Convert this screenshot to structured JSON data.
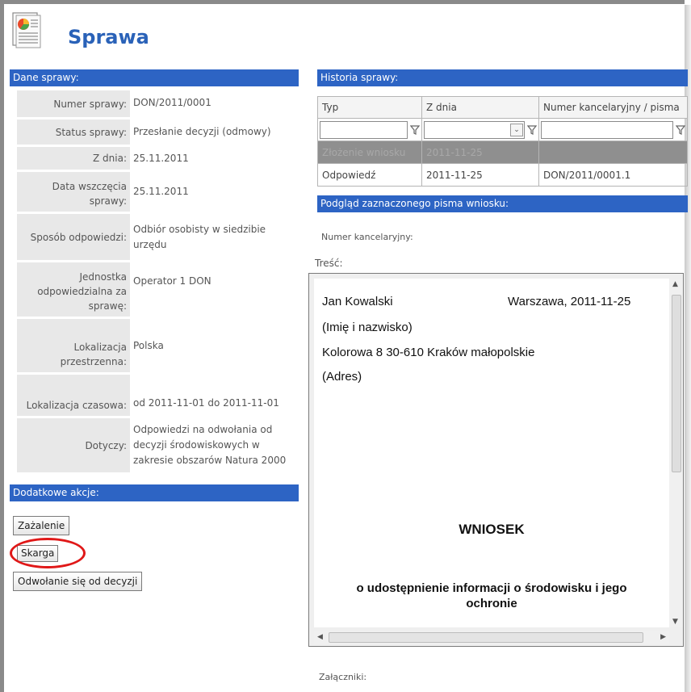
{
  "page": {
    "title": "Sprawa"
  },
  "dane": {
    "header": "Dane sprawy:",
    "rows": [
      {
        "label": "Numer sprawy:",
        "value": "DON/2011/0001"
      },
      {
        "label": "Status sprawy:",
        "value": "Przesłanie decyzji (odmowy)"
      },
      {
        "label": "Z dnia:",
        "value": "25.11.2011"
      },
      {
        "label": "Data wszczęcia sprawy:",
        "value": "25.11.2011"
      },
      {
        "label": "Sposób odpowiedzi:",
        "value": "Odbiór osobisty w siedzibie urzędu"
      },
      {
        "label": "Jednostka odpowiedzialna za sprawę:",
        "value": "Operator 1 DON"
      },
      {
        "label": "Lokalizacja przestrzenna:",
        "value": "Polska"
      },
      {
        "label": "Lokalizacja czasowa:",
        "value": "od 2011-11-01 do 2011-11-01"
      },
      {
        "label": "Dotyczy:",
        "value": "Odpowiedzi na odwołania od decyzji środowiskowych w zakresie obszarów Natura 2000"
      }
    ]
  },
  "akcje": {
    "header": "Dodatkowe akcje:",
    "buttons": [
      "Zażalenie",
      "Skarga",
      "Odwołanie się od decyzji"
    ]
  },
  "historia": {
    "header": "Historia sprawy:",
    "columns": [
      "Typ",
      "Z dnia",
      "Numer kancelaryjny / pisma"
    ],
    "rows": [
      {
        "typ": "Złożenie wniosku",
        "data": "2011-11-25",
        "numer": ""
      },
      {
        "typ": "Odpowiedź",
        "data": "2011-11-25",
        "numer": "DON/2011/0001.1"
      }
    ]
  },
  "podglad": {
    "header": "Podgląd zaznaczonego pisma wniosku:",
    "numer_label": "Numer kancelaryjny:",
    "tresc_label": "Treść:",
    "zalaczniki_label": "Załączniki:",
    "doc": {
      "name": "Jan Kowalski",
      "place_date": "Warszawa, 2011-11-25",
      "name_caption": "(Imię i nazwisko)",
      "address": "Kolorowa 8 30-610 Kraków małopolskie",
      "address_caption": "(Adres)",
      "heading": "WNIOSEK",
      "subheading_1": "o udostępnienie informacji o środowisku i jego",
      "subheading_2": "ochronie"
    }
  },
  "colors": {
    "accent": "#2d64c4",
    "title": "#2a62b8",
    "highlight": "#e01818"
  }
}
